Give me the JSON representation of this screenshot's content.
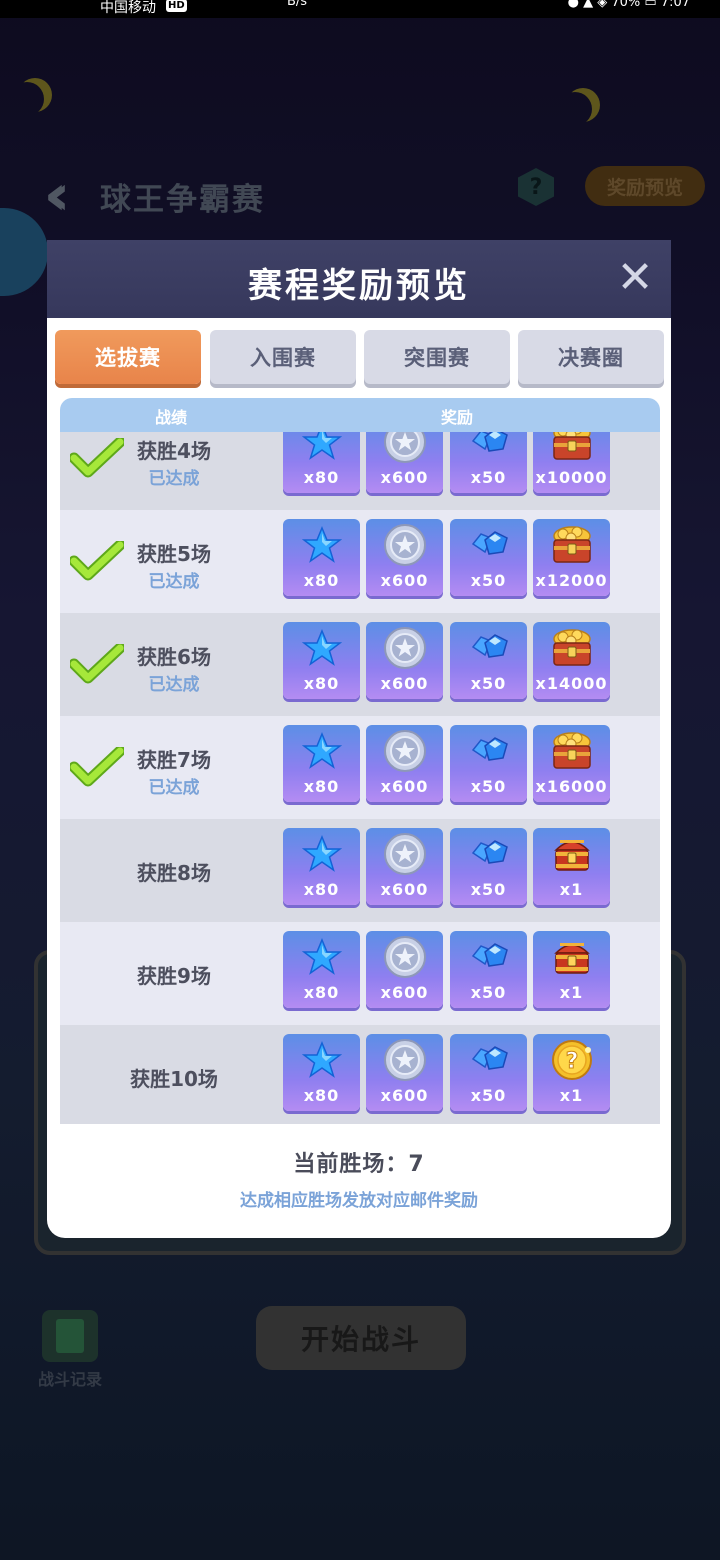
{
  "status_bar": {
    "carrier": "中国移动",
    "hd_badge": "HD",
    "speed_unit": "B/s",
    "right_info": "● ▲ ◈ 70%  ▭ 7:07"
  },
  "background": {
    "title": "球王争霸赛",
    "help_label": "?",
    "reward_preview_btn": "奖励预览",
    "battle_log_label": "战斗记录",
    "start_btn": "开始战斗"
  },
  "modal": {
    "title": "赛程奖励预览",
    "close_label": "✕",
    "tabs": [
      {
        "label": "选拔赛",
        "active": true
      },
      {
        "label": "入围赛",
        "active": false
      },
      {
        "label": "突围赛",
        "active": false
      },
      {
        "label": "决赛圈",
        "active": false
      }
    ],
    "columns": {
      "record": "战绩",
      "reward": "奖励"
    },
    "rows": [
      {
        "win": "获胜4场",
        "status": "已达成",
        "achieved": true,
        "rewards": [
          {
            "icon": "star-icon",
            "qty": "x80"
          },
          {
            "icon": "silver-coin-icon",
            "qty": "x600"
          },
          {
            "icon": "diamond-icon",
            "qty": "x50"
          },
          {
            "icon": "gold-chest-icon",
            "qty": "x10000"
          }
        ]
      },
      {
        "win": "获胜5场",
        "status": "已达成",
        "achieved": true,
        "rewards": [
          {
            "icon": "star-icon",
            "qty": "x80"
          },
          {
            "icon": "silver-coin-icon",
            "qty": "x600"
          },
          {
            "icon": "diamond-icon",
            "qty": "x50"
          },
          {
            "icon": "gold-chest-icon",
            "qty": "x12000"
          }
        ]
      },
      {
        "win": "获胜6场",
        "status": "已达成",
        "achieved": true,
        "rewards": [
          {
            "icon": "star-icon",
            "qty": "x80"
          },
          {
            "icon": "silver-coin-icon",
            "qty": "x600"
          },
          {
            "icon": "diamond-icon",
            "qty": "x50"
          },
          {
            "icon": "gold-chest-icon",
            "qty": "x14000"
          }
        ]
      },
      {
        "win": "获胜7场",
        "status": "已达成",
        "achieved": true,
        "rewards": [
          {
            "icon": "star-icon",
            "qty": "x80"
          },
          {
            "icon": "silver-coin-icon",
            "qty": "x600"
          },
          {
            "icon": "diamond-icon",
            "qty": "x50"
          },
          {
            "icon": "gold-chest-icon",
            "qty": "x16000"
          }
        ]
      },
      {
        "win": "获胜8场",
        "status": "",
        "achieved": false,
        "rewards": [
          {
            "icon": "star-icon",
            "qty": "x80"
          },
          {
            "icon": "silver-coin-icon",
            "qty": "x600"
          },
          {
            "icon": "diamond-icon",
            "qty": "x50"
          },
          {
            "icon": "red-chest-icon",
            "qty": "x1"
          }
        ]
      },
      {
        "win": "获胜9场",
        "status": "",
        "achieved": false,
        "rewards": [
          {
            "icon": "star-icon",
            "qty": "x80"
          },
          {
            "icon": "silver-coin-icon",
            "qty": "x600"
          },
          {
            "icon": "diamond-icon",
            "qty": "x50"
          },
          {
            "icon": "red-chest-icon",
            "qty": "x1"
          }
        ]
      },
      {
        "win": "获胜10场",
        "status": "",
        "achieved": false,
        "rewards": [
          {
            "icon": "star-icon",
            "qty": "x80"
          },
          {
            "icon": "silver-coin-icon",
            "qty": "x600"
          },
          {
            "icon": "diamond-icon",
            "qty": "x50"
          },
          {
            "icon": "mystery-coin-icon",
            "qty": "x1"
          }
        ]
      }
    ],
    "current_wins_label": "当前胜场：7",
    "note": "达成相应胜场发放对应邮件奖励"
  },
  "colors": {
    "tab_active": "#e8844a",
    "header_bg": "#3f4166",
    "table_head": "#a8cbf0",
    "reward_tile": "#8f7ff0",
    "achieved_text": "#7ba3d8",
    "check_green": "#8fdc2a"
  }
}
